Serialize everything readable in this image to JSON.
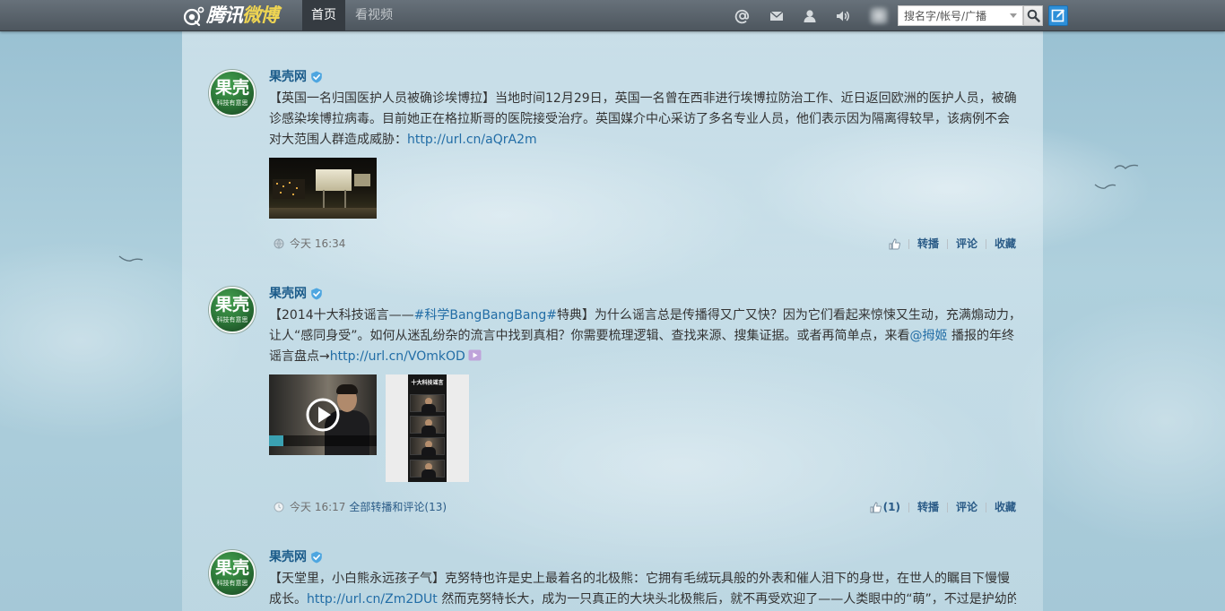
{
  "topbar": {
    "logo_a": "腾讯",
    "logo_b": "微博",
    "nav": [
      {
        "label": "首页"
      },
      {
        "label": "看视频"
      }
    ],
    "search_placeholder": "搜名字/帐号/广播"
  },
  "icons": {
    "logo": "weibo-logo-icon",
    "mention": "at-icon",
    "messages": "mail-icon",
    "profile": "user-icon",
    "sound": "speaker-icon",
    "search_dropdown": "chevron-down-icon",
    "search": "search-icon",
    "compose": "compose-icon",
    "verified": "verified-badge-icon",
    "like": "thumbs-up-icon",
    "play": "play-icon",
    "video_link": "video-link-icon",
    "visibility": "globe-icon",
    "time": "clock-icon"
  },
  "colors": {
    "link": "#226da6",
    "author": "#1b5b8a",
    "text": "#333333",
    "action": "#2a5b87",
    "compose_button": "#2d8fd8",
    "active_tab": "#353b41"
  },
  "posts": [
    {
      "author": "果壳网",
      "avatar_main": "果壳",
      "avatar_sub": "科技有意思",
      "lines": [
        [
          "【英国一名归国医护人员被确诊埃博拉】当地时间12月29日，英国一名曾在西非进行埃博拉防治工作、近日返回欧洲的医护人员，被确"
        ],
        [
          "诊感染埃博拉病毒。目前她正在格拉斯哥的医院接受治疗。英国媒介中心采访了多名专业人员，他们表示因为隔离得较早，该病例不会"
        ],
        [
          "对大范围人群造成威胁：",
          "http://url.cn/aQrA2m"
        ]
      ],
      "time": "今天 16:34",
      "actions": {
        "retweet": "转播",
        "comment": "评论",
        "favorite": "收藏"
      }
    },
    {
      "author": "果壳网",
      "avatar_main": "果壳",
      "avatar_sub": "科技有意思",
      "lines": [
        [
          "【2014十大科技谣言——",
          "#科学BangBangBang#",
          "特典】为什么谣言总是传播得又广又快？因为它们看起来惊悚又生动，充满煽动力，"
        ],
        [
          "让人“感同身受”。如何从迷乱纷杂的流言中找到真相？你需要梳理逻辑、查找来源、搜集证据。或者再简单点，来看",
          "@拇姬",
          " 播报的年终"
        ],
        [
          "谣言盘点→",
          "http://url.cn/VOmkOD"
        ]
      ],
      "image_caption": "十大科技谣言",
      "time": "今天 16:17",
      "thread_link": "全部转播和评论(13)",
      "like_count": "(1)",
      "actions": {
        "retweet": "转播",
        "comment": "评论",
        "favorite": "收藏"
      }
    },
    {
      "author": "果壳网",
      "avatar_main": "果壳",
      "avatar_sub": "科技有意思",
      "lines": [
        [
          "【天堂里，小白熊永远孩子气】克努特也许是史上最着名的北极熊：它拥有毛绒玩具般的外表和催人泪下的身世，在世人的瞩目下慢慢"
        ],
        [
          "成长。",
          "http://url.cn/Zm2DUt",
          " 然而克努特长大，成为一只真正的大块头北极熊后，就不再受欢迎了——人类眼中的“萌”，不过是护幼的"
        ]
      ]
    }
  ]
}
